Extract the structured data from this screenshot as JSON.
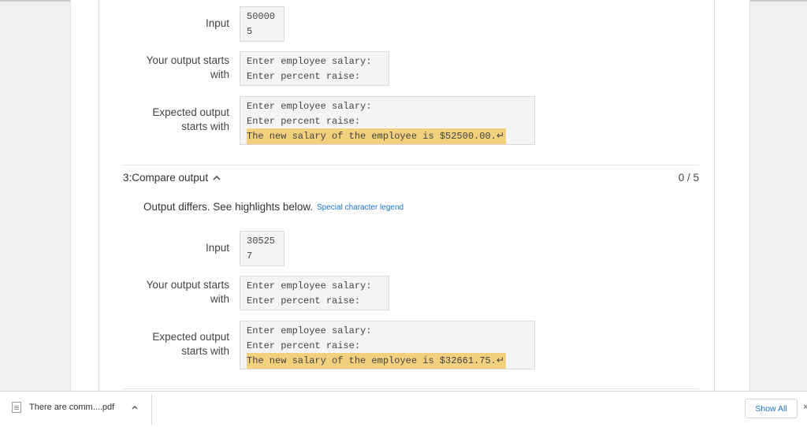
{
  "test_prev": {
    "input_label": "Input",
    "input_lines": [
      "50000",
      "5"
    ],
    "your_label": [
      "Your output starts",
      "with"
    ],
    "your_lines": [
      "Enter employee salary:",
      "Enter percent raise:"
    ],
    "expected_label": [
      "Expected output",
      "starts with"
    ],
    "expected_lines": [
      "Enter employee salary:",
      "Enter percent raise:"
    ],
    "expected_highlight": "The new salary of the employee is $52500.00.",
    "return_glyph": "↵"
  },
  "test3": {
    "heading": "3:Compare output",
    "toggle_icon": "chevron-up-icon",
    "score": "0 / 5",
    "differs_text": "Output differs. See highlights below.",
    "legend_link": "Special character legend",
    "input_label": "Input",
    "input_lines": [
      "30525",
      "7"
    ],
    "your_label": [
      "Your output starts",
      "with"
    ],
    "your_lines": [
      "Enter employee salary:",
      "Enter percent raise:"
    ],
    "expected_label": [
      "Expected output",
      "starts with"
    ],
    "expected_lines": [
      "Enter employee salary:",
      "Enter percent raise:"
    ],
    "expected_highlight": "The new salary of the employee is $32661.75.",
    "return_glyph": "↵"
  },
  "download_bar": {
    "file_name": "There are comm....pdf",
    "file_icon": "pdf-file-icon",
    "chevron": "^",
    "show_all": "Show All",
    "close": "×"
  },
  "colors": {
    "highlight": "#f3d07e",
    "link": "#1a73c8"
  }
}
